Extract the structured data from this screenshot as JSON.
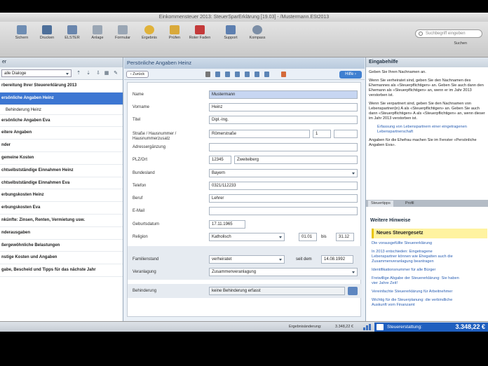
{
  "window": {
    "title": "Einkommensteuer 2013: SteuerSparErklärung [19.03] - /Mustermann.ESt2013"
  },
  "toolbar": {
    "buttons": [
      {
        "label": "Sichern",
        "color": "#6e8db3"
      },
      {
        "label": "Drucken",
        "color": "#4d6f9a"
      },
      {
        "label": "ELSTER",
        "color": "#6a86ad"
      },
      {
        "label": "Anlage",
        "color": "#9aa6b4"
      },
      {
        "label": "Formular",
        "color": "#9aa6b4"
      },
      {
        "label": "Ergebnis",
        "color": "#e0b23a"
      },
      {
        "label": "Prüfen",
        "color": "#d9a93a"
      },
      {
        "label": "Roter Faden",
        "color": "#c43a3a"
      },
      {
        "label": "Support",
        "color": "#5d7fb0"
      },
      {
        "label": "Kompass",
        "color": "#7c8ea6"
      }
    ],
    "search_placeholder": "Suchbegriff eingeben",
    "search_label": "Suchen"
  },
  "sidebar": {
    "header": "er",
    "filter": "alle Dialoge",
    "items": [
      {
        "label": "rbereitung Ihrer Steuererklärung 2013",
        "sub": false,
        "active": false
      },
      {
        "label": "ersönliche Angaben Heinz",
        "sub": false,
        "active": true
      },
      {
        "label": "Behinderung Heinz",
        "sub": true,
        "active": false
      },
      {
        "label": "ersönliche Angaben Eva",
        "sub": false,
        "active": false
      },
      {
        "label": "eitere Angaben",
        "sub": false,
        "active": false
      },
      {
        "label": "nder",
        "sub": false,
        "active": false
      },
      {
        "label": "gemeine Kosten",
        "sub": false,
        "active": false
      },
      {
        "label": "chtselbstständige Einnahmen Heinz",
        "sub": false,
        "active": false
      },
      {
        "label": "chtselbstständige Einnahmen Eva",
        "sub": false,
        "active": false
      },
      {
        "label": "erbungskosten Heinz",
        "sub": false,
        "active": false
      },
      {
        "label": "erbungskosten Eva",
        "sub": false,
        "active": false
      },
      {
        "label": "nkünfte: Zinsen, Renten, Vermietung usw.",
        "sub": false,
        "active": false
      },
      {
        "label": "nderausgaben",
        "sub": false,
        "active": false
      },
      {
        "label": "ßergewöhnliche Belastungen",
        "sub": false,
        "active": false
      },
      {
        "label": "nstige Kosten und Angaben",
        "sub": false,
        "active": false
      },
      {
        "label": "gabe, Bescheid und Tipps für das nächste Jahr",
        "sub": false,
        "active": false
      }
    ]
  },
  "center": {
    "header": "Persönliche Angaben Heinz",
    "back_label": "‹ Zurück",
    "help_label": "Hilfe ›",
    "form": {
      "name_label": "Name",
      "name_value": "Mustermann",
      "vorname_label": "Vorname",
      "vorname_value": "Heinz",
      "titel_label": "Titel",
      "titel_value": "Dipl.-Ing.",
      "strasse_label": "Straße / Hausnummer / Hausnummerzusatz",
      "strasse_value": "Römerstraße",
      "hausnr_value": "1",
      "hauszusatz_value": "",
      "adress_label": "Adressergänzung",
      "adress_value": "",
      "plz_label": "PLZ/Ort",
      "plz_value": "12345",
      "ort_value": "Zweiteiberg",
      "bundesland_label": "Bundesland",
      "bundesland_value": "Bayern",
      "telefon_label": "Telefon",
      "telefon_value": "0321/112233",
      "beruf_label": "Beruf",
      "beruf_value": "Lehrer",
      "email_label": "E-Mail",
      "email_value": "",
      "geburt_label": "Geburtsdatum",
      "geburt_value": "17.11.1965",
      "religion_label": "Religion",
      "religion_value": "Katholisch",
      "rel_from": "01.01",
      "rel_bis_label": "bis",
      "rel_to": "31.12",
      "familie_label": "Familienstand",
      "familie_value": "verheiratet",
      "seit_label": "seit dem",
      "seit_value": "14.08.1992",
      "veranl_label": "Veranlagung",
      "veranl_value": "Zusammenveranlagung",
      "behind_label": "Behinderung",
      "behind_value": "keine Behinderung erfasst"
    }
  },
  "right": {
    "header": "Eingabehilfe",
    "p1": "Geben Sie Ihren Nachnamen an.",
    "p2": "Wenn Sie verheiratet sind, geben Sie den Nachnamen des Ehemannes als «Steuerpflichtigen» an. Geben Sie auch dann den Ehemann als «Steuerpflichtigen» an, wenn er im Jahr 2013 verstorben ist.",
    "p3": "Wenn Sie verpartnert sind, geben Sie den Nachnamen von Lebenspartner(in) A als «Steuerpflichtigen» an. Geben Sie auch dann «Steuerpflichtigen» A als «Steuerpflichtigen» an, wenn dieser im Jahr 2013 verstorben ist.",
    "link1": "Erfassung von Lebenspartnern einer eingetragenen Lebenspartnerschaft",
    "p4": "Angaben für die Ehefrau machen Sie im Fenster «Persönliche Angaben Eva».",
    "tab1": "Steuertipps",
    "tab2": "Profil",
    "hints_head": "Weitere Hinweise",
    "yellow": "Neues Steuergesetz",
    "links": [
      "Die vorausgefüllte Steuererklärung",
      "In 2013 entschieden: Eingetragene",
      "Lebenspartner können wie Ehegatten auch die",
      "Zusammenveranlagung beantragen",
      "Identifikationsnummer für alle Bürger",
      "Freiwillige Abgabe der Steuererklärung: Sie haben",
      "vier Jahre Zeit!",
      "Vereinfachte Steuererklärung für Arbeitnehmer",
      "Wichtig für die Steuerplanung: die verbindliche",
      "Auskunft vom Finanzamt"
    ]
  },
  "statusbar": {
    "ergebnis_label": "Ergebnisänderung:",
    "ergebnis_value": "3.348,22 €",
    "erstattung_label": "Steuererstattung:",
    "erstattung_value": "3.348,22 €"
  }
}
